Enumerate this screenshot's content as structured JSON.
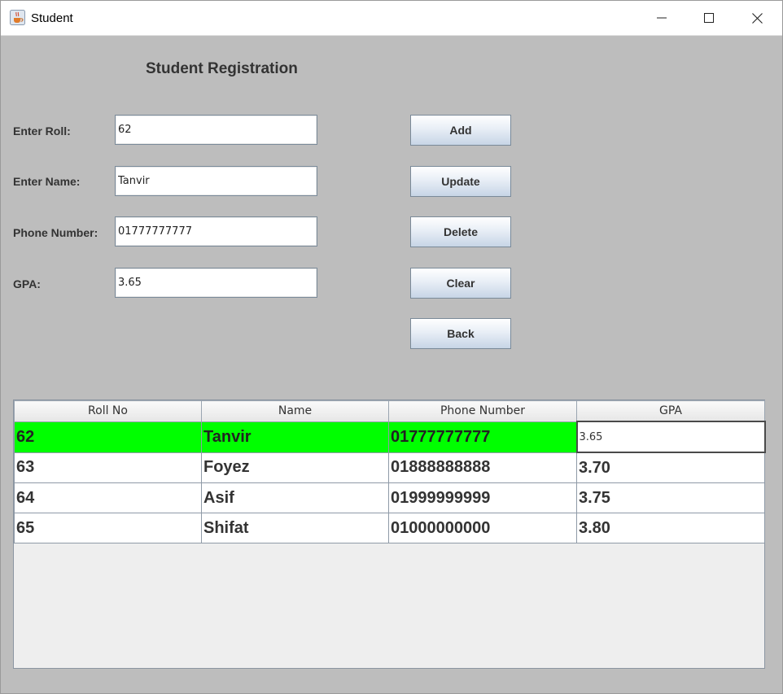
{
  "window": {
    "title": "Student",
    "icon": "java-cup-icon",
    "controls": [
      "minimize-icon",
      "maximize-icon",
      "close-icon"
    ]
  },
  "form": {
    "heading": "Student Registration",
    "roll": {
      "label": "Enter Roll:",
      "value": "62"
    },
    "name": {
      "label": "Enter Name:",
      "value": "Tanvir"
    },
    "phone": {
      "label": "Phone Number:",
      "value": "01777777777"
    },
    "gpa": {
      "label": "GPA:",
      "value": "3.65"
    }
  },
  "buttons": {
    "add": "Add",
    "update": "Update",
    "delete": "Delete",
    "clear": "Clear",
    "back": "Back"
  },
  "table": {
    "columns": [
      "Roll No",
      "Name",
      "Phone Number",
      "GPA"
    ],
    "rows": [
      [
        "62",
        "Tanvir",
        "01777777777",
        "3.65"
      ],
      [
        "63",
        "Foyez",
        "01888888888",
        "3.70"
      ],
      [
        "64",
        "Asif",
        "01999999999",
        "3.75"
      ],
      [
        "65",
        "Shifat",
        "01000000000",
        "3.80"
      ]
    ],
    "selected_row_color": "#00ff00"
  }
}
